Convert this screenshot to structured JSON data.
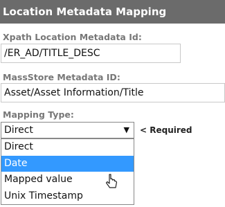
{
  "header": {
    "title": "Location Metadata Mapping"
  },
  "xpath": {
    "label": "Xpath Location Metadata Id:",
    "value": "/ER_AD/TITLE_DESC"
  },
  "massstore": {
    "label": "MassStore Metadata ID:",
    "value": "Asset/Asset Information/Title"
  },
  "mapping": {
    "label": "Mapping Type:",
    "selected": "Direct",
    "required_text": "< Required",
    "options": [
      "Direct",
      "Date",
      "Mapped value",
      "Unix Timestamp"
    ],
    "highlighted": "Date"
  },
  "colors": {
    "header_bg": "#6b6b6b",
    "highlight": "#3399ff",
    "label": "#777777"
  }
}
